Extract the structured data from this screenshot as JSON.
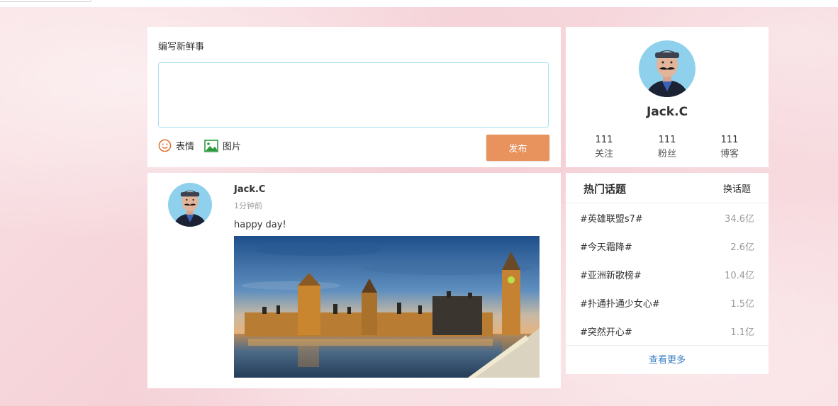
{
  "composer": {
    "title": "编写新鲜事",
    "emoji_label": "表情",
    "image_label": "图片",
    "publish_label": "发布",
    "input_value": ""
  },
  "profile": {
    "name": "Jack.C",
    "stats": [
      {
        "count": "111",
        "label": "关注"
      },
      {
        "count": "111",
        "label": "粉丝"
      },
      {
        "count": "111",
        "label": "博客"
      }
    ]
  },
  "post": {
    "author": "Jack.C",
    "time": "1分钟前",
    "text": "happy day!"
  },
  "topics": {
    "title": "热门话题",
    "refresh_label": "换话题",
    "items": [
      {
        "name": "#英雄联盟s7#",
        "count": "34.6亿"
      },
      {
        "name": "#今天霜降#",
        "count": "2.6亿"
      },
      {
        "name": "#亚洲新歌榜#",
        "count": "10.4亿"
      },
      {
        "name": "#扑通扑通少女心#",
        "count": "1.5亿"
      },
      {
        "name": "#突然开心#",
        "count": "1.1亿"
      }
    ],
    "more_label": "查看更多"
  },
  "colors": {
    "accent_button": "#e8925e",
    "link": "#3b7fc4",
    "background": "#f7d9dd"
  },
  "icons": {
    "emoji": "smiley-icon",
    "image": "picture-icon"
  }
}
